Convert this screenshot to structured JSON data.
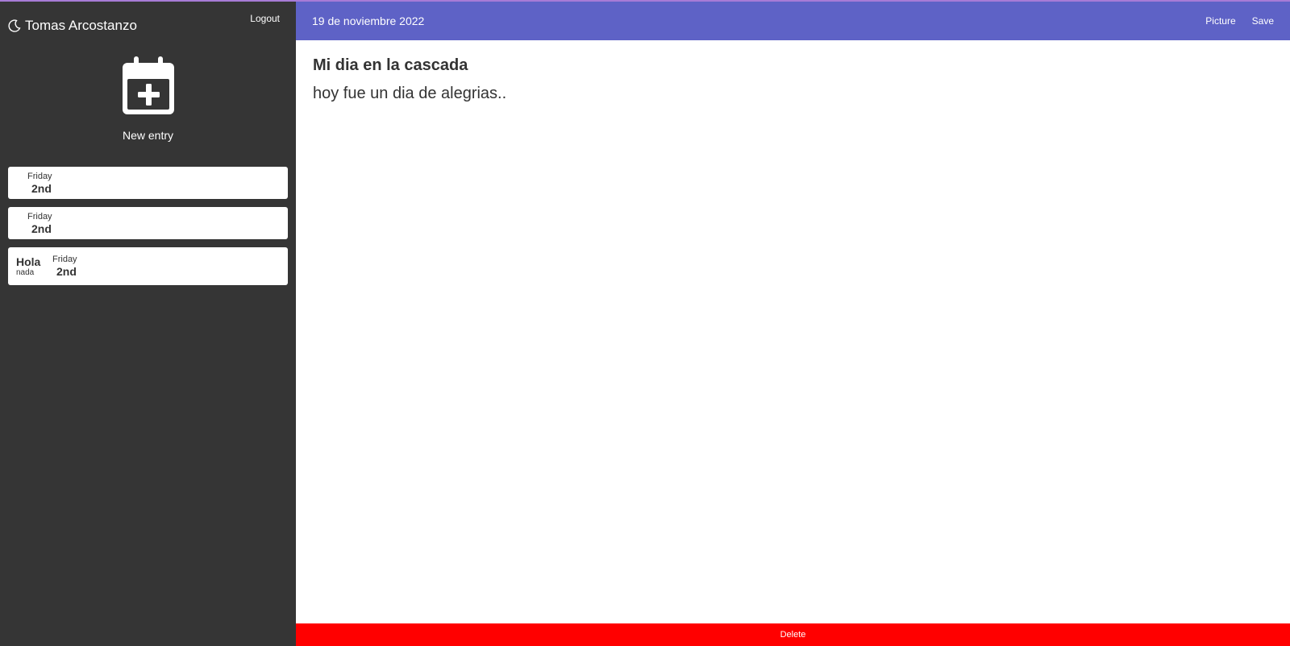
{
  "sidebar": {
    "user_name": "Tomas Arcostanzo",
    "logout_label": "Logout",
    "new_entry_label": "New entry",
    "entries": [
      {
        "title": "",
        "subtitle": "",
        "day": "Friday",
        "date": "2nd"
      },
      {
        "title": "",
        "subtitle": "",
        "day": "Friday",
        "date": "2nd"
      },
      {
        "title": "Hola",
        "subtitle": "nada",
        "day": "Friday",
        "date": "2nd"
      }
    ]
  },
  "header": {
    "date": "19 de noviembre 2022",
    "picture_label": "Picture",
    "save_label": "Save"
  },
  "editor": {
    "title": "Mi dia en la cascada",
    "body": "hoy fue un dia de alegrias.."
  },
  "footer": {
    "delete_label": "Delete"
  },
  "colors": {
    "sidebar_bg": "#353535",
    "header_bg": "#5e62c6",
    "delete_bg": "#ff0000"
  }
}
